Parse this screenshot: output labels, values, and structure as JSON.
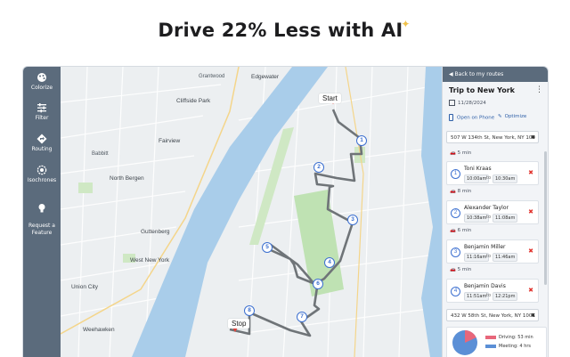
{
  "headline": "Drive 22% Less with AI",
  "sidebar": {
    "items": [
      {
        "label": "Colorize",
        "icon": "palette-icon"
      },
      {
        "label": "Filter",
        "icon": "sliders-icon"
      },
      {
        "label": "Routing",
        "icon": "routing-icon"
      },
      {
        "label": "Isochrones",
        "icon": "isochrone-icon"
      },
      {
        "label": "Request a\nFeature",
        "icon": "lightbulb-icon"
      }
    ]
  },
  "map": {
    "labels": [
      "Edgewater",
      "Grantwood",
      "Cliffside Park",
      "Fairview",
      "Babbitt",
      "North Bergen",
      "Guttenberg",
      "West New York",
      "Union City",
      "Weehawken",
      "Start",
      "Stop"
    ],
    "stops": [
      "1",
      "2",
      "3",
      "4",
      "5",
      "6",
      "7",
      "8"
    ],
    "colors": {
      "water": "#a9cdea",
      "park": "#bfe2b3",
      "route": "#6f7478",
      "stop": "#3b6fd0",
      "pin": "#e8433a"
    }
  },
  "panel": {
    "back_label": "◀ Back to my routes",
    "trip_title": "Trip to New York",
    "kebab": "⋮",
    "date": "11/28/2024",
    "open_on_phone": "Open on Phone",
    "optimize": "Optimize",
    "start_address": "507 W 134th St, New York, NY 100",
    "end_address": "432 W 58th St, New York, NY 1001",
    "drive_times": [
      "5 min",
      "8 min",
      "6 min",
      "5 min"
    ],
    "stops": [
      {
        "num": "1",
        "name": "Toni Kraas",
        "from": "10:00am",
        "to": "10:30am"
      },
      {
        "num": "2",
        "name": "Alexander Taylor",
        "from": "10:38am",
        "to": "11:08am"
      },
      {
        "num": "3",
        "name": "Benjamin Miller",
        "from": "11:16am",
        "to": "11:46am"
      },
      {
        "num": "4",
        "name": "Benjamin Davis",
        "from": "11:51am",
        "to": "12:21pm"
      }
    ],
    "to_word": "to",
    "remove": "✖",
    "summary": {
      "driving": "Driving: 53 min",
      "meeting": "Meeting: 4 hrs",
      "driving_color": "#e8677b",
      "meeting_color": "#5b8fd6",
      "driving_minutes": 53,
      "meeting_minutes": 240
    }
  }
}
